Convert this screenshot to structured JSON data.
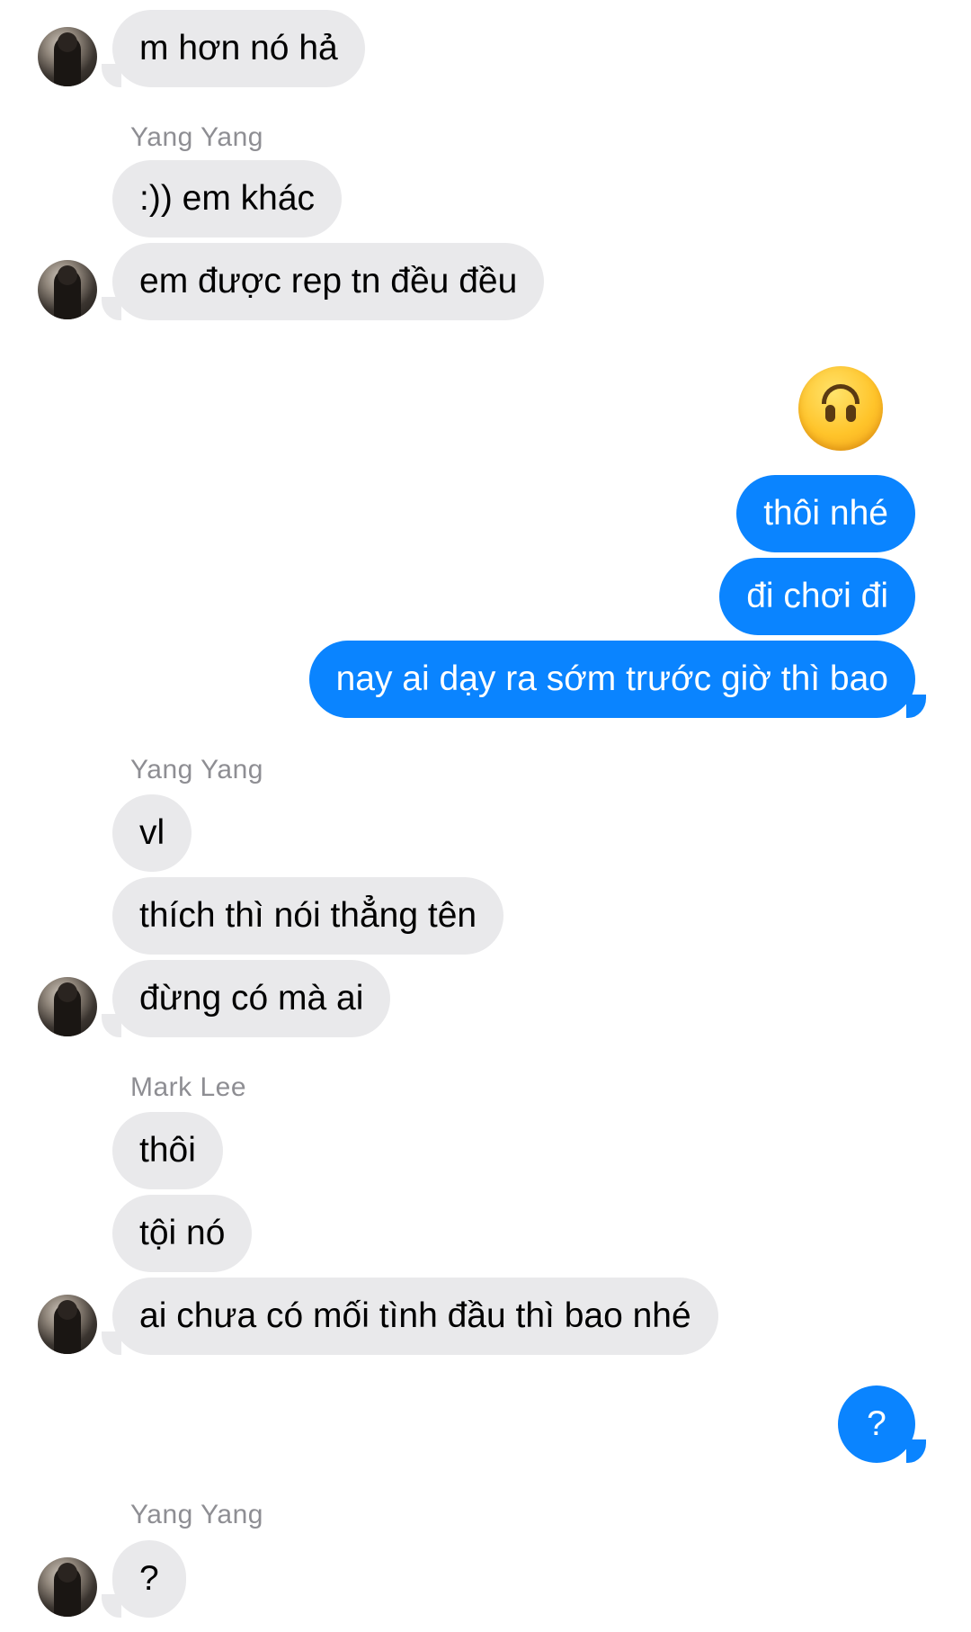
{
  "conversation": {
    "messages": [
      {
        "sender": "",
        "text": "m hơn nó hả"
      },
      {
        "sender": "Yang Yang",
        "text": ":)) em khác"
      },
      {
        "sender": "",
        "text": "em được rep tn đều đều"
      },
      {
        "sender": "me",
        "text": "🙃"
      },
      {
        "sender": "me",
        "text": "thôi nhé"
      },
      {
        "sender": "me",
        "text": "đi chơi đi"
      },
      {
        "sender": "me",
        "text": "nay ai dạy ra sớm trước giờ thì bao"
      },
      {
        "sender": "Yang Yang",
        "text": "vl"
      },
      {
        "sender": "",
        "text": "thích thì nói thẳng tên"
      },
      {
        "sender": "",
        "text": "đừng có mà ai"
      },
      {
        "sender": "Mark Lee",
        "text": "thôi"
      },
      {
        "sender": "",
        "text": "tội nó"
      },
      {
        "sender": "",
        "text": "ai chưa có mối tình đầu thì bao nhé"
      },
      {
        "sender": "me",
        "text": "?"
      },
      {
        "sender": "Yang Yang",
        "text": "?"
      }
    ]
  },
  "colors": {
    "incoming_bubble": "#e9e9eb",
    "outgoing_bubble": "#0a84ff",
    "sender_label": "#8e8e93"
  },
  "icons": {
    "emoji": "upside-down-face-emoji"
  }
}
